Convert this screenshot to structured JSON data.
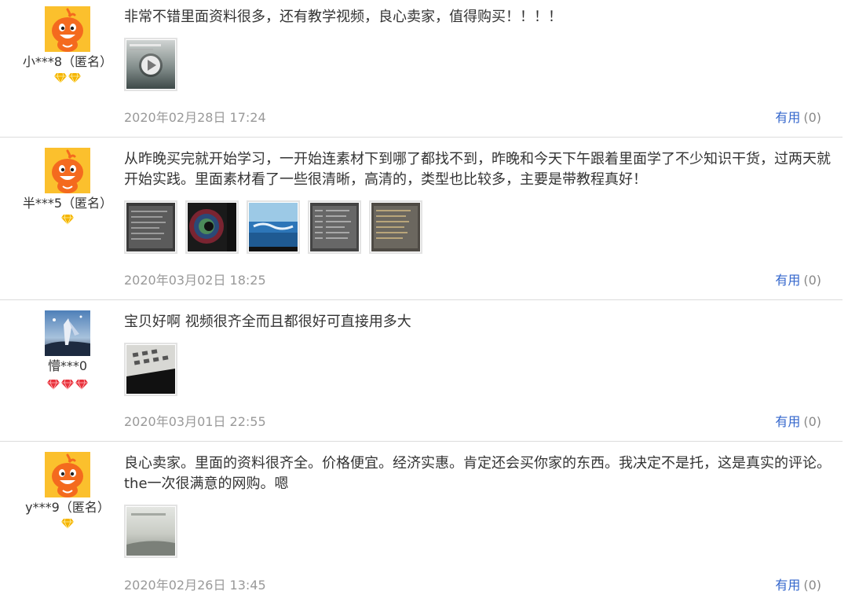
{
  "reviews": [
    {
      "username": "小***8（匿名）",
      "text": "非常不错里面资料很多，还有教学视频，良心卖家，值得购买！！！！",
      "date": "2020年02月28日 17:24",
      "useful_label": "有用",
      "useful_count": "(0)"
    },
    {
      "username": "半***5（匿名）",
      "text": "从昨晚买完就开始学习，一开始连素材下到哪了都找不到，昨晚和今天下午跟着里面学了不少知识干货，过两天就开始实践。里面素材看了一些很清晰，高清的，类型也比较多，主要是带教程真好！",
      "date": "2020年03月02日 18:25",
      "useful_label": "有用",
      "useful_count": "(0)"
    },
    {
      "username": "懵***0",
      "text": "宝贝好啊 视频很齐全而且都很好可直接用多大",
      "date": "2020年03月01日 22:55",
      "useful_label": "有用",
      "useful_count": "(0)"
    },
    {
      "username": "y***9（匿名）",
      "text": "良心卖家。里面的资料很齐全。价格便宜。经济实惠。肯定还会买你家的东西。我决定不是托，这是真实的评论。the一次很满意的网购。嗯",
      "date": "2020年02月26日 13:45",
      "useful_label": "有用",
      "useful_count": "(0)"
    }
  ],
  "colors": {
    "link": "#3366cc",
    "date": "#999999",
    "text": "#333333",
    "divider": "#dcdcdc",
    "avatar_orange": "#f46a1e",
    "diamond_gold": "#f5b400",
    "diamond_red": "#e8323c"
  }
}
